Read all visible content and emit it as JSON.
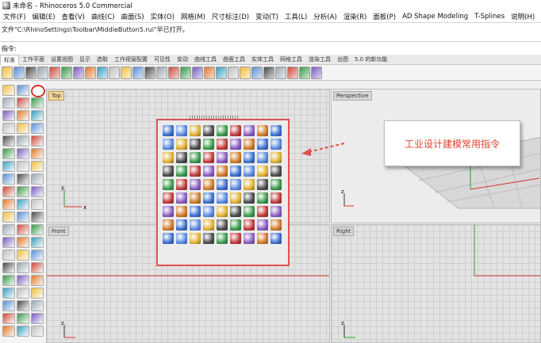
{
  "window": {
    "title": "未命名 - Rhinoceros 5.0 Commercial"
  },
  "menu": [
    "文件(F)",
    "编辑(E)",
    "查看(V)",
    "曲线(C)",
    "曲面(S)",
    "实体(O)",
    "网格(M)",
    "尺寸标注(D)",
    "变动(T)",
    "工具(L)",
    "分析(A)",
    "渲染(R)",
    "面板(P)",
    "AD Shape Modeling",
    "T-Splines",
    "说明(H)"
  ],
  "command_history": "文件\"C:\\RhinoSettings\\Toolbar\\MiddleButton5.rui\"早已打开。",
  "command_prompt": "指令:",
  "tabs": [
    "标准",
    "工作平面",
    "设置视图",
    "显示",
    "选取",
    "工作视窗配置",
    "可见性",
    "变动",
    "曲线工具",
    "曲面工具",
    "实体工具",
    "网格工具",
    "渲染工具",
    "出图",
    "5.0 的新功能"
  ],
  "viewports": {
    "top": "Top",
    "perspective": "Perspective",
    "front": "Front",
    "right": "Right"
  },
  "axis_labels": {
    "x": "x",
    "y": "y",
    "z": "z"
  },
  "callout_text": "工业设计建模常用指令",
  "colors": {
    "accent_red": "#d9534f",
    "callout_text": "#e0402a",
    "viewport_bg": "#e3e3e3",
    "active_label": "#f2d79b"
  },
  "icons": {
    "toolbar": [
      "new-file",
      "open-file",
      "save-file",
      "print",
      "cut",
      "copy",
      "paste",
      "undo",
      "redo",
      "pan",
      "rotate-view",
      "zoom",
      "zoom-window",
      "zoom-extents",
      "rotate-view-2",
      "grid-toggle",
      "show-layers",
      "render-preview",
      "lightbulb",
      "material",
      "color-circle",
      "sphere",
      "shade",
      "render",
      "cylinder",
      "options",
      "help"
    ],
    "popup_count": 81
  }
}
